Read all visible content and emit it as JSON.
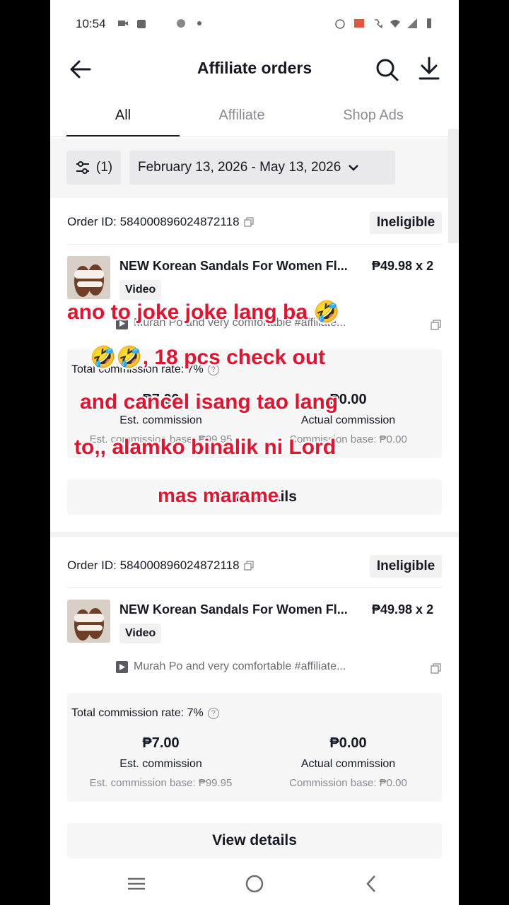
{
  "status_bar": {
    "time": "10:54"
  },
  "header": {
    "title": "Affiliate orders"
  },
  "tabs": [
    {
      "label": "All"
    },
    {
      "label": "Affiliate"
    },
    {
      "label": "Shop Ads"
    }
  ],
  "filters": {
    "filter_count": "(1)",
    "date_range": "February 13, 2026 - May 13, 2026"
  },
  "orders": [
    {
      "order_id": "Order ID: 584000896024872118",
      "status": "Ineligible",
      "product_name": "NEW Korean Sandals For Women Fl...",
      "price_qty": "₱49.98 x 2",
      "tag": "Video",
      "video_title": "Murah Po and very comfortable #affiliate...",
      "commission_rate": "Total commission rate: 7%",
      "est_commission": "₱7.00",
      "est_label": "Est. commission",
      "est_base": "Est. commission base: ₱99.95",
      "actual_commission": "₱0.00",
      "actual_label": "Actual commission",
      "actual_base": "Commission base: ₱0.00",
      "details_label": "View details"
    },
    {
      "order_id": "Order ID: 584000896024872118",
      "status": "Ineligible",
      "product_name": "NEW Korean Sandals For Women Fl...",
      "price_qty": "₱49.98 x 2",
      "tag": "Video",
      "video_title": "Murah Po and very comfortable #affiliate...",
      "commission_rate": "Total commission rate: 7%",
      "est_commission": "₱7.00",
      "est_label": "Est. commission",
      "est_base": "Est. commission base: ₱99.95",
      "actual_commission": "₱0.00",
      "actual_label": "Actual commission",
      "actual_base": "Commission base: ₱0.00",
      "details_label": "View details"
    }
  ],
  "caption": {
    "line1": "ano to joke joke lang ba 🤣",
    "line2": "🤣🤣, 18 pcs check out",
    "line3": "and cancel isang tao lang",
    "line4": "to,, alamko binalik ni Lord",
    "line5": "mas marame"
  },
  "colors": {
    "caption_red": "#e8112d",
    "text_dark": "#161823",
    "muted": "#8a8b91"
  },
  "icons": [
    "back-arrow-icon",
    "search-icon",
    "download-icon",
    "filter-icon",
    "chevron-down-icon",
    "copy-icon",
    "play-icon",
    "open-external-icon",
    "help-icon",
    "menu-nav-icon",
    "home-nav-icon",
    "back-nav-icon"
  ]
}
